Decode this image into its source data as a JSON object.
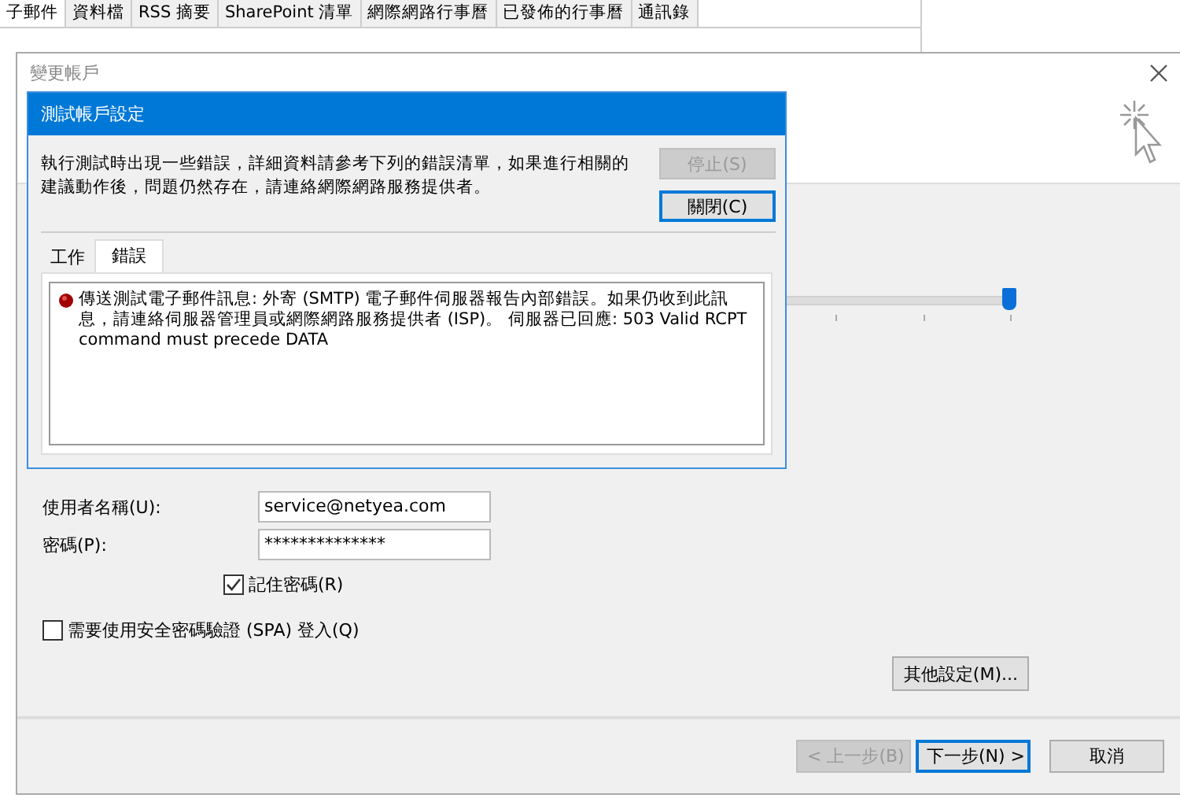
{
  "background_tabs": [
    {
      "label": "子郵件",
      "selected": true
    },
    {
      "label": "資料檔",
      "selected": false
    },
    {
      "label": "RSS 摘要",
      "selected": false
    },
    {
      "label": "SharePoint 清單",
      "selected": false
    },
    {
      "label": "網際網路行事曆",
      "selected": false
    },
    {
      "label": "已發佈的行事曆",
      "selected": false
    },
    {
      "label": "通訊錄",
      "selected": false
    }
  ],
  "dialog": {
    "title": "變更帳戶",
    "slider": {
      "level": 1
    },
    "login": {
      "fields": [
        {
          "label": "使用者名稱(U):",
          "value": "service@netyea.com"
        },
        {
          "label": "密碼(P):",
          "value": "**************"
        }
      ],
      "checkboxes": [
        {
          "label": "記住密碼(R)",
          "checked": true
        },
        {
          "label": "需要使用安全密碼驗證 (SPA) 登入(Q)",
          "checked": false
        }
      ]
    },
    "more_settings": "其他設定(M)...",
    "buttons": [
      {
        "label": "< 上一步(B)",
        "disabled": true,
        "default": false
      },
      {
        "label": "下一步(N) >",
        "disabled": false,
        "default": true
      },
      {
        "label": "取消",
        "disabled": false,
        "default": false
      }
    ]
  },
  "test_dialog": {
    "title": "測試帳戶設定",
    "message": "執行測試時出現一些錯誤，詳細資料請參考下列的錯誤清單，如果進行相關的建議動作後，問題仍然存在，請連絡網際網路服務提供者。",
    "buttons": [
      {
        "label": "停止(S)",
        "disabled": true,
        "default": false
      },
      {
        "label": "關閉(C)",
        "disabled": false,
        "default": true
      }
    ],
    "tabs": [
      {
        "label": "工作",
        "selected": false
      },
      {
        "label": "錯誤",
        "selected": true
      }
    ],
    "errors": [
      {
        "text": "傳送測試電子郵件訊息: 外寄 (SMTP) 電子郵件伺服器報告內部錯誤。如果仍收到此訊息，請連絡伺服器管理員或網際網路服務提供者 (ISP)。 伺服器已回應: 503 Valid RCPT command must precede DATA"
      }
    ]
  }
}
